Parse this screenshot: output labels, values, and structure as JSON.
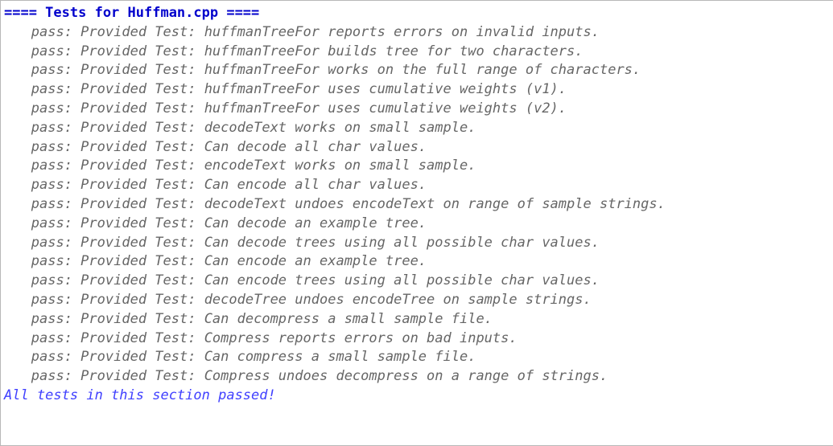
{
  "header": "==== Tests for Huffman.cpp ====",
  "tests": [
    "pass: Provided Test: huffmanTreeFor reports errors on invalid inputs.",
    "pass: Provided Test: huffmanTreeFor builds tree for two characters.",
    "pass: Provided Test: huffmanTreeFor works on the full range of characters.",
    "pass: Provided Test: huffmanTreeFor uses cumulative weights (v1).",
    "pass: Provided Test: huffmanTreeFor uses cumulative weights (v2).",
    "pass: Provided Test: decodeText works on small sample.",
    "pass: Provided Test: Can decode all char values.",
    "pass: Provided Test: encodeText works on small sample.",
    "pass: Provided Test: Can encode all char values.",
    "pass: Provided Test: decodeText undoes encodeText on range of sample strings.",
    "pass: Provided Test: Can decode an example tree.",
    "pass: Provided Test: Can decode trees using all possible char values.",
    "pass: Provided Test: Can encode an example tree.",
    "pass: Provided Test: Can encode trees using all possible char values.",
    "pass: Provided Test: decodeTree undoes encodeTree on sample strings.",
    "pass: Provided Test: Can decompress a small sample file.",
    "pass: Provided Test: Compress reports errors on bad inputs.",
    "pass: Provided Test: Can compress a small sample file.",
    "pass: Provided Test: Compress undoes decompress on a range of strings."
  ],
  "summary": "All tests in this section passed!"
}
